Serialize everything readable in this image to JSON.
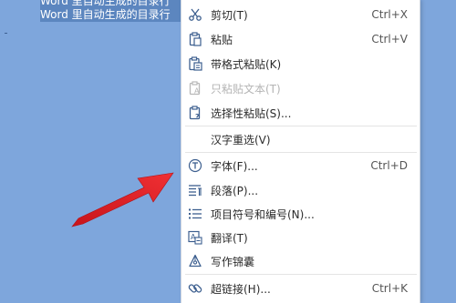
{
  "document": {
    "lines": [
      "Word 里自动生成的目录行",
      "Word 里自动生成的目录行"
    ]
  },
  "context_menu": {
    "items": [
      {
        "label": "剪切(T)",
        "shortcut": "Ctrl+X",
        "icon": "scissors-icon",
        "enabled": true
      },
      {
        "label": "粘贴",
        "shortcut": "Ctrl+V",
        "icon": "clipboard-icon",
        "enabled": true
      },
      {
        "label": "带格式粘贴(K)",
        "shortcut": "",
        "icon": "paste-formatted-icon",
        "enabled": true
      },
      {
        "label": "只粘贴文本(T)",
        "shortcut": "",
        "icon": "paste-text-icon",
        "enabled": false
      },
      {
        "label": "选择性粘贴(S)...",
        "shortcut": "",
        "icon": "paste-special-icon",
        "enabled": true
      },
      {
        "label": "汉字重选(V)",
        "shortcut": "",
        "icon": "",
        "enabled": true
      },
      {
        "label": "字体(F)...",
        "shortcut": "Ctrl+D",
        "icon": "font-icon",
        "enabled": true
      },
      {
        "label": "段落(P)...",
        "shortcut": "",
        "icon": "paragraph-icon",
        "enabled": true
      },
      {
        "label": "项目符号和编号(N)...",
        "shortcut": "",
        "icon": "bullet-list-icon",
        "enabled": true
      },
      {
        "label": "翻译(T)",
        "shortcut": "",
        "icon": "translate-icon",
        "enabled": true
      },
      {
        "label": "写作锦囊",
        "shortcut": "",
        "icon": "writing-tips-icon",
        "enabled": true
      },
      {
        "label": "超链接(H)...",
        "shortcut": "Ctrl+K",
        "icon": "link-icon",
        "enabled": true
      }
    ]
  },
  "colors": {
    "background": "#7ea6dc",
    "selection": "#5c86bf",
    "arrow": "#e8262a",
    "menu_icon": "#3d5f8f"
  }
}
